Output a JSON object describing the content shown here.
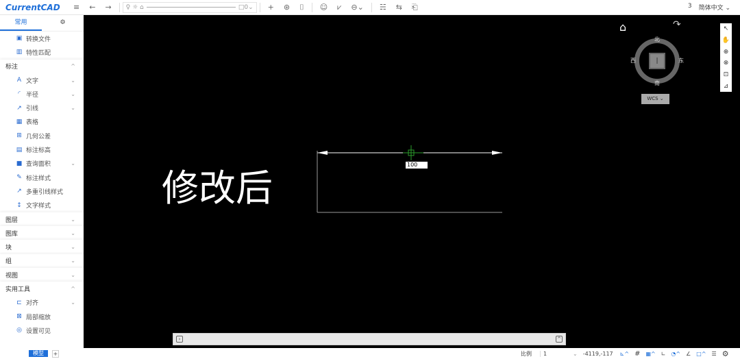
{
  "app": {
    "logo": "CurrentCAD"
  },
  "toolbar": {
    "layer_name": "0",
    "page_num": "3",
    "language": "简体中文"
  },
  "sidebar": {
    "tabs": [
      "常用",
      "⚙"
    ],
    "top_items": [
      {
        "icon": "▣",
        "label": "转换文件"
      },
      {
        "icon": "▥",
        "label": "特性匹配"
      }
    ],
    "annotate": {
      "label": "标注",
      "items": [
        {
          "icon": "A",
          "label": "文字",
          "chev": true
        },
        {
          "icon": "◜",
          "label": "半径",
          "chev": true
        },
        {
          "icon": "↗",
          "label": "引线",
          "chev": true
        },
        {
          "icon": "▦",
          "label": "表格",
          "chev": false
        },
        {
          "icon": "⊞",
          "label": "几何公差",
          "chev": false
        },
        {
          "icon": "▤",
          "label": "标注标高",
          "chev": false
        },
        {
          "icon": "■",
          "label": "查询面积",
          "chev": true
        },
        {
          "icon": "✎",
          "label": "标注样式",
          "chev": false
        },
        {
          "icon": "↗",
          "label": "多重引线样式",
          "chev": false
        },
        {
          "icon": "↕",
          "label": "文字样式",
          "chev": false
        }
      ]
    },
    "sections": [
      "图层",
      "图库",
      "块",
      "组",
      "视图"
    ],
    "utility": {
      "label": "实用工具",
      "items": [
        {
          "icon": "⊏",
          "label": "对齐",
          "chev": true
        },
        {
          "icon": "⊠",
          "label": "局部缩放"
        },
        {
          "icon": "◎",
          "label": "设置可见"
        }
      ]
    }
  },
  "canvas": {
    "annotation": "修改后",
    "dim_input": "100"
  },
  "viewcube": {
    "north": "北",
    "south": "南",
    "east": "东",
    "west": "西",
    "ucs": "WCS"
  },
  "bottom": {
    "tab_model": "模型",
    "add": "+",
    "scale_label": "比例",
    "scale_value": "1",
    "coords": "-4119,-117"
  }
}
